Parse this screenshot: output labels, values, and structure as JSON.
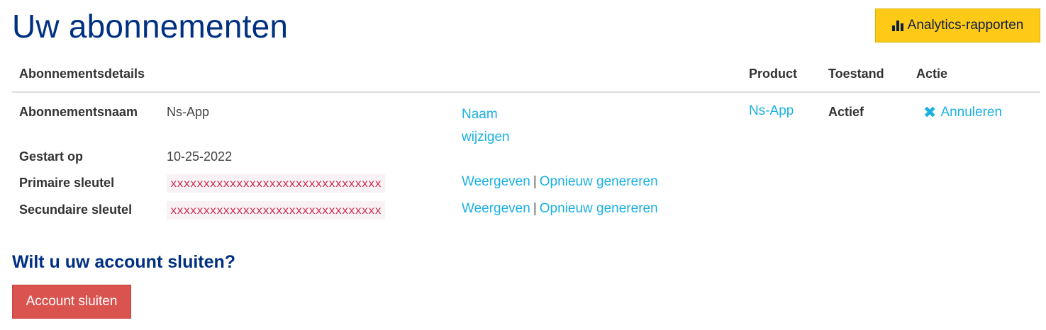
{
  "page": {
    "title": "Uw abonnementen",
    "analytics_button": "Analytics-rapporten"
  },
  "table": {
    "headers": {
      "details": "Abonnementsdetails",
      "product": "Product",
      "state": "Toestand",
      "action": "Actie"
    },
    "subscription": {
      "name_label": "Abonnementsnaam",
      "name_value": "Ns-App",
      "rename_link_line1": "Naam",
      "rename_link_line2": "wijzigen",
      "started_label": "Gestart op",
      "started_value": "10-25-2022",
      "primary_key_label": "Primaire sleutel",
      "primary_key_value": "xxxxxxxxxxxxxxxxxxxxxxxxxxxxxxxx",
      "secondary_key_label": "Secundaire sleutel",
      "secondary_key_value": "xxxxxxxxxxxxxxxxxxxxxxxxxxxxxxxx",
      "show_link": "Weergeven",
      "separator": "|",
      "regenerate_link": "Opnieuw genereren",
      "product": "Ns-App",
      "state": "Actief",
      "cancel_link": "Annuleren"
    }
  },
  "close_account": {
    "heading": "Wilt u uw account sluiten?",
    "button": "Account sluiten"
  },
  "colors": {
    "title": "#003082",
    "link": "#1ab0e3",
    "analytics_button_bg": "#ffc917",
    "danger_button_bg": "#d9534f",
    "key_text": "#c7254e",
    "key_bg": "#f9f2f4"
  },
  "icons": {
    "analytics": "bar-chart-icon",
    "cancel": "close-x-icon"
  }
}
